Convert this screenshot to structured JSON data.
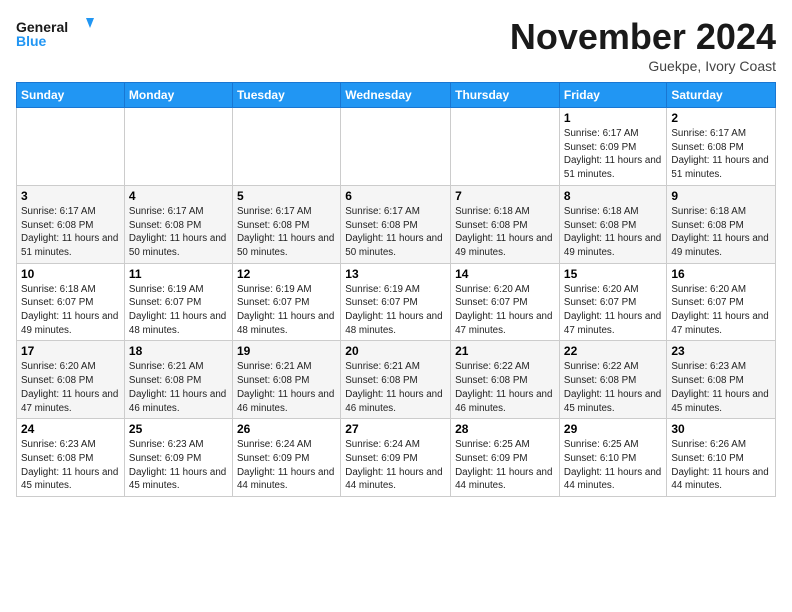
{
  "header": {
    "logo_line1": "General",
    "logo_line2": "Blue",
    "month_title": "November 2024",
    "location": "Guekpe, Ivory Coast"
  },
  "weekdays": [
    "Sunday",
    "Monday",
    "Tuesday",
    "Wednesday",
    "Thursday",
    "Friday",
    "Saturday"
  ],
  "weeks": [
    [
      {
        "day": "",
        "info": ""
      },
      {
        "day": "",
        "info": ""
      },
      {
        "day": "",
        "info": ""
      },
      {
        "day": "",
        "info": ""
      },
      {
        "day": "",
        "info": ""
      },
      {
        "day": "1",
        "info": "Sunrise: 6:17 AM\nSunset: 6:09 PM\nDaylight: 11 hours and 51 minutes."
      },
      {
        "day": "2",
        "info": "Sunrise: 6:17 AM\nSunset: 6:08 PM\nDaylight: 11 hours and 51 minutes."
      }
    ],
    [
      {
        "day": "3",
        "info": "Sunrise: 6:17 AM\nSunset: 6:08 PM\nDaylight: 11 hours and 51 minutes."
      },
      {
        "day": "4",
        "info": "Sunrise: 6:17 AM\nSunset: 6:08 PM\nDaylight: 11 hours and 50 minutes."
      },
      {
        "day": "5",
        "info": "Sunrise: 6:17 AM\nSunset: 6:08 PM\nDaylight: 11 hours and 50 minutes."
      },
      {
        "day": "6",
        "info": "Sunrise: 6:17 AM\nSunset: 6:08 PM\nDaylight: 11 hours and 50 minutes."
      },
      {
        "day": "7",
        "info": "Sunrise: 6:18 AM\nSunset: 6:08 PM\nDaylight: 11 hours and 49 minutes."
      },
      {
        "day": "8",
        "info": "Sunrise: 6:18 AM\nSunset: 6:08 PM\nDaylight: 11 hours and 49 minutes."
      },
      {
        "day": "9",
        "info": "Sunrise: 6:18 AM\nSunset: 6:08 PM\nDaylight: 11 hours and 49 minutes."
      }
    ],
    [
      {
        "day": "10",
        "info": "Sunrise: 6:18 AM\nSunset: 6:07 PM\nDaylight: 11 hours and 49 minutes."
      },
      {
        "day": "11",
        "info": "Sunrise: 6:19 AM\nSunset: 6:07 PM\nDaylight: 11 hours and 48 minutes."
      },
      {
        "day": "12",
        "info": "Sunrise: 6:19 AM\nSunset: 6:07 PM\nDaylight: 11 hours and 48 minutes."
      },
      {
        "day": "13",
        "info": "Sunrise: 6:19 AM\nSunset: 6:07 PM\nDaylight: 11 hours and 48 minutes."
      },
      {
        "day": "14",
        "info": "Sunrise: 6:20 AM\nSunset: 6:07 PM\nDaylight: 11 hours and 47 minutes."
      },
      {
        "day": "15",
        "info": "Sunrise: 6:20 AM\nSunset: 6:07 PM\nDaylight: 11 hours and 47 minutes."
      },
      {
        "day": "16",
        "info": "Sunrise: 6:20 AM\nSunset: 6:07 PM\nDaylight: 11 hours and 47 minutes."
      }
    ],
    [
      {
        "day": "17",
        "info": "Sunrise: 6:20 AM\nSunset: 6:08 PM\nDaylight: 11 hours and 47 minutes."
      },
      {
        "day": "18",
        "info": "Sunrise: 6:21 AM\nSunset: 6:08 PM\nDaylight: 11 hours and 46 minutes."
      },
      {
        "day": "19",
        "info": "Sunrise: 6:21 AM\nSunset: 6:08 PM\nDaylight: 11 hours and 46 minutes."
      },
      {
        "day": "20",
        "info": "Sunrise: 6:21 AM\nSunset: 6:08 PM\nDaylight: 11 hours and 46 minutes."
      },
      {
        "day": "21",
        "info": "Sunrise: 6:22 AM\nSunset: 6:08 PM\nDaylight: 11 hours and 46 minutes."
      },
      {
        "day": "22",
        "info": "Sunrise: 6:22 AM\nSunset: 6:08 PM\nDaylight: 11 hours and 45 minutes."
      },
      {
        "day": "23",
        "info": "Sunrise: 6:23 AM\nSunset: 6:08 PM\nDaylight: 11 hours and 45 minutes."
      }
    ],
    [
      {
        "day": "24",
        "info": "Sunrise: 6:23 AM\nSunset: 6:08 PM\nDaylight: 11 hours and 45 minutes."
      },
      {
        "day": "25",
        "info": "Sunrise: 6:23 AM\nSunset: 6:09 PM\nDaylight: 11 hours and 45 minutes."
      },
      {
        "day": "26",
        "info": "Sunrise: 6:24 AM\nSunset: 6:09 PM\nDaylight: 11 hours and 44 minutes."
      },
      {
        "day": "27",
        "info": "Sunrise: 6:24 AM\nSunset: 6:09 PM\nDaylight: 11 hours and 44 minutes."
      },
      {
        "day": "28",
        "info": "Sunrise: 6:25 AM\nSunset: 6:09 PM\nDaylight: 11 hours and 44 minutes."
      },
      {
        "day": "29",
        "info": "Sunrise: 6:25 AM\nSunset: 6:10 PM\nDaylight: 11 hours and 44 minutes."
      },
      {
        "day": "30",
        "info": "Sunrise: 6:26 AM\nSunset: 6:10 PM\nDaylight: 11 hours and 44 minutes."
      }
    ]
  ]
}
